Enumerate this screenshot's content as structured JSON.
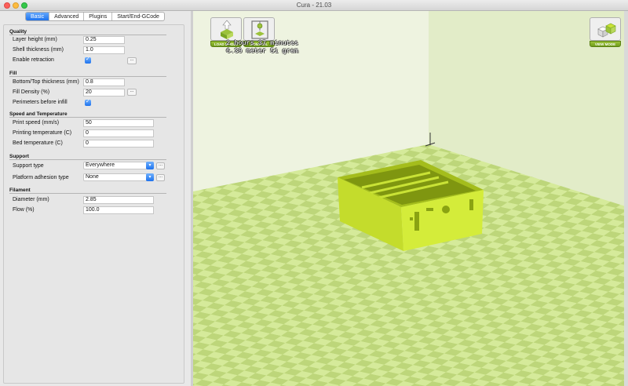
{
  "window": {
    "title": "Cura - 21.03"
  },
  "tabs": [
    "Basic",
    "Advanced",
    "Plugins",
    "Start/End-GCode"
  ],
  "sections": {
    "quality": "Quality",
    "fill": "Fill",
    "speed": "Speed and Temperature",
    "support": "Support",
    "filament": "Filament"
  },
  "fields": {
    "layer_height": {
      "label": "Layer height (mm)",
      "value": "0.25"
    },
    "shell_thickness": {
      "label": "Shell thickness (mm)",
      "value": "1.0"
    },
    "enable_retraction": {
      "label": "Enable retraction",
      "checked": true
    },
    "bottom_top_thickness": {
      "label": "Bottom/Top thickness (mm)",
      "value": "0.8"
    },
    "fill_density": {
      "label": "Fill Density (%)",
      "value": "20"
    },
    "perimeters_before_infill": {
      "label": "Perimeters before infill",
      "checked": true
    },
    "print_speed": {
      "label": "Print speed (mm/s)",
      "value": "50"
    },
    "printing_temperature": {
      "label": "Printing temperature (C)",
      "value": "0"
    },
    "bed_temperature": {
      "label": "Bed temperature (C)",
      "value": "0"
    },
    "support_type": {
      "label": "Support type",
      "value": "Everywhere"
    },
    "platform_adhesion": {
      "label": "Platform adhesion type",
      "value": "None"
    },
    "diameter": {
      "label": "Diameter (mm)",
      "value": "2.85"
    },
    "flow": {
      "label": "Flow (%)",
      "value": "100.0"
    }
  },
  "buttons": {
    "more": "..."
  },
  "toolbar": {
    "load_model": "LOAD MODEL",
    "control": "CONTROL",
    "view_mode": "VIEW MODE"
  },
  "stats": {
    "time": "2 hours 37 minutes",
    "material": "6.39 meter 51 gram"
  },
  "colors": {
    "accent_blue": "#1e72ee",
    "bed_light": "#d5ea9a",
    "bed_dark": "#bdd67a",
    "model": "#c9e236",
    "toolbar_green": "#7aa623"
  },
  "icons": [
    "close-icon",
    "minimize-icon",
    "maximize-icon",
    "checkbox-icon",
    "chevron-down-icon",
    "load-model-icon",
    "control-icon",
    "view-mode-icon"
  ]
}
